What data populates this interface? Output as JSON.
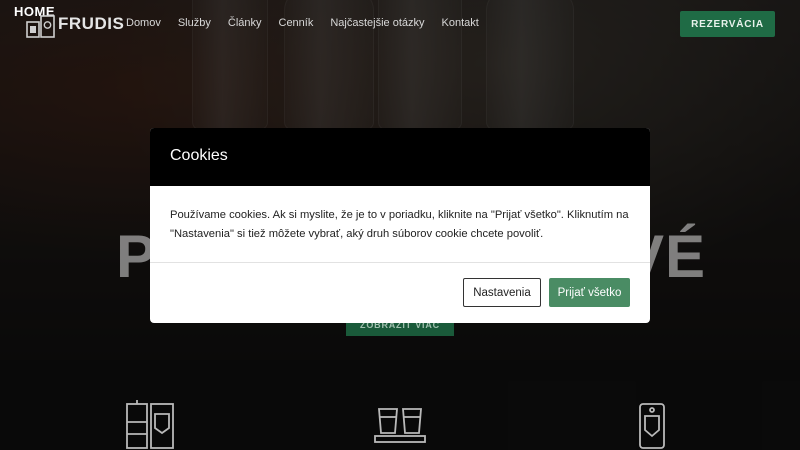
{
  "nav": {
    "logo_home": "HOME",
    "logo_text": "FRUDIS",
    "items": [
      "Domov",
      "Služby",
      "Články",
      "Cenník",
      "Najčastejšie otázky",
      "Kontakt"
    ],
    "reserve_label": "REZERVÁCIA"
  },
  "hero": {
    "headline_left": "PÁ",
    "headline_right": "VÉ",
    "more_label": "ZOBRAZIŤ VIAC"
  },
  "modal": {
    "title": "Cookies",
    "text": "Používame cookies. Ak si myslite, že je to v poriadku, kliknite na \"Prijať všetko\". Kliknutím na \"Nastavenia\" si tiež môžete vybrať, aký druh súborov cookie chcete povoliť.",
    "settings_label": "Nastavenia",
    "accept_label": "Prijať všetko"
  },
  "colors": {
    "accent_green": "#4a8c64",
    "reserve_green": "#1f6b45",
    "modal_header": "#000000"
  },
  "icons": [
    "distiller-icon",
    "shot-glasses-icon",
    "shield-tool-icon"
  ]
}
